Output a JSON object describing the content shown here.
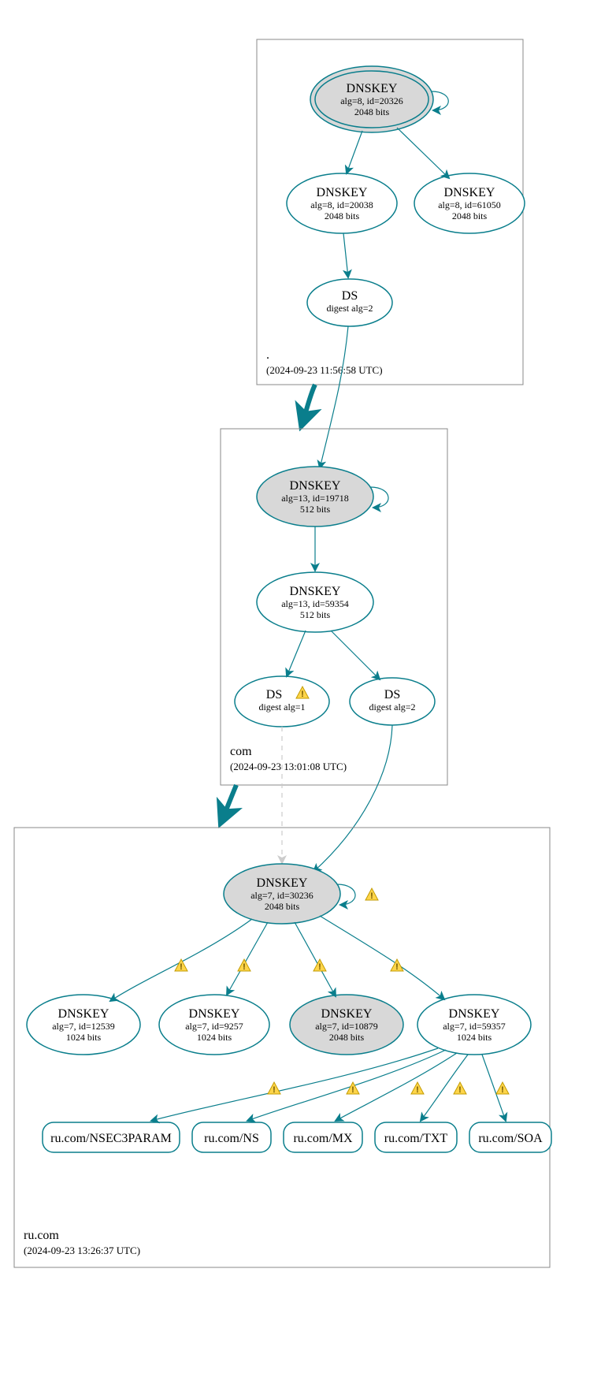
{
  "color": {
    "stroke": "#0a7e8c",
    "fill_grey": "#d8d8d8",
    "edge_grey": "#cccccc",
    "warn_fill": "#ffd54a",
    "warn_stroke": "#c29b00"
  },
  "zones": {
    "root": {
      "name": ".",
      "timestamp": "(2024-09-23 11:56:58 UTC)"
    },
    "com": {
      "name": "com",
      "timestamp": "(2024-09-23 13:01:08 UTC)"
    },
    "rucom": {
      "name": "ru.com",
      "timestamp": "(2024-09-23 13:26:37 UTC)"
    }
  },
  "nodes": {
    "root_ksk": {
      "title": "DNSKEY",
      "sub1": "alg=8, id=20326",
      "sub2": "2048 bits"
    },
    "root_zsk1": {
      "title": "DNSKEY",
      "sub1": "alg=8, id=20038",
      "sub2": "2048 bits"
    },
    "root_zsk2": {
      "title": "DNSKEY",
      "sub1": "alg=8, id=61050",
      "sub2": "2048 bits"
    },
    "root_ds": {
      "title": "DS",
      "sub1": "digest alg=2"
    },
    "com_ksk": {
      "title": "DNSKEY",
      "sub1": "alg=13, id=19718",
      "sub2": "512 bits"
    },
    "com_zsk": {
      "title": "DNSKEY",
      "sub1": "alg=13, id=59354",
      "sub2": "512 bits"
    },
    "com_ds1": {
      "title": "DS",
      "warn_suffix": "⚠",
      "sub1": "digest alg=1"
    },
    "com_ds2": {
      "title": "DS",
      "sub1": "digest alg=2"
    },
    "ru_ksk": {
      "title": "DNSKEY",
      "sub1": "alg=7, id=30236",
      "sub2": "2048 bits"
    },
    "ru_k1": {
      "title": "DNSKEY",
      "sub1": "alg=7, id=12539",
      "sub2": "1024 bits"
    },
    "ru_k2": {
      "title": "DNSKEY",
      "sub1": "alg=7, id=9257",
      "sub2": "1024 bits"
    },
    "ru_k3": {
      "title": "DNSKEY",
      "sub1": "alg=7, id=10879",
      "sub2": "2048 bits"
    },
    "ru_k4": {
      "title": "DNSKEY",
      "sub1": "alg=7, id=59357",
      "sub2": "1024 bits"
    },
    "ru_nsec3p": {
      "label": "ru.com/NSEC3PARAM"
    },
    "ru_ns": {
      "label": "ru.com/NS"
    },
    "ru_mx": {
      "label": "ru.com/MX"
    },
    "ru_txt": {
      "label": "ru.com/TXT"
    },
    "ru_soa": {
      "label": "ru.com/SOA"
    }
  }
}
